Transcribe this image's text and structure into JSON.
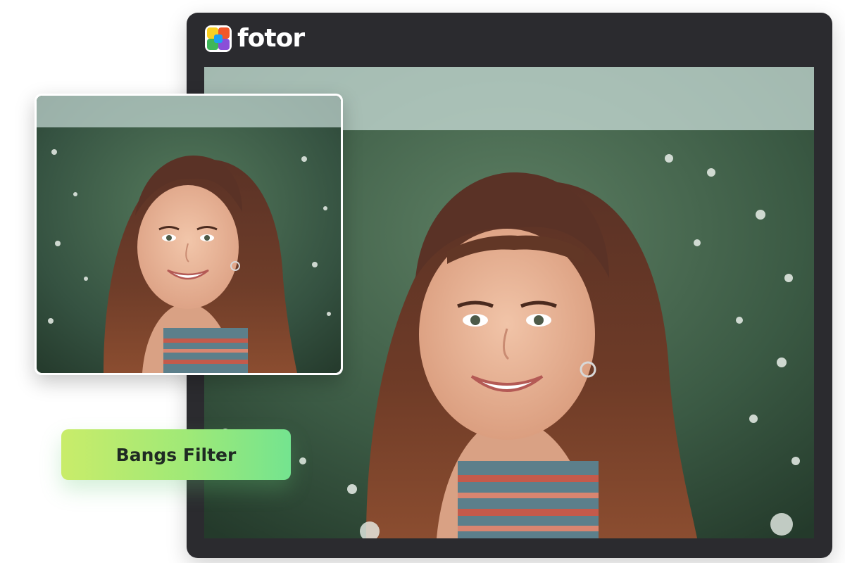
{
  "brand": {
    "name": "fotor",
    "logo_icon": "fotor-logo-icon"
  },
  "main_photo": {
    "icon": "portrait-photo-after-bangs",
    "subject": "smiling woman with bangs in front of flowering bush"
  },
  "original_photo": {
    "icon": "portrait-photo-original",
    "subject": "smiling woman without bangs in front of flowering bush"
  },
  "filter": {
    "label": "Bangs Filter"
  },
  "colors": {
    "window_bg": "#2b2b2f",
    "badge_start": "#c9ec6a",
    "badge_end": "#74e48f",
    "badge_text": "#1f2a23"
  }
}
